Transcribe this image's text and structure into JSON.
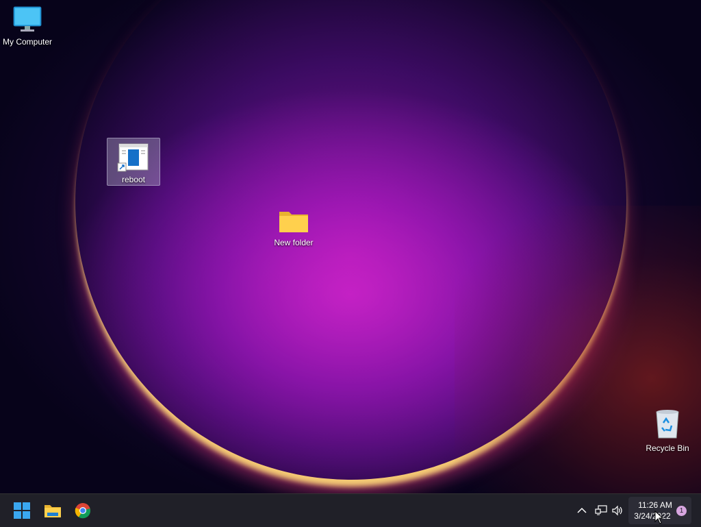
{
  "desktop": {
    "icons": [
      {
        "label": "My Computer"
      },
      {
        "label": "reboot"
      },
      {
        "label": "New folder"
      },
      {
        "label": "Recycle Bin"
      }
    ]
  },
  "taskbar": {
    "pinned": [
      "start-icon",
      "file-explorer-icon",
      "chrome-icon"
    ],
    "tray": {
      "time": "11:26 AM",
      "date": "3/24/2022",
      "notification_count": "1"
    }
  }
}
